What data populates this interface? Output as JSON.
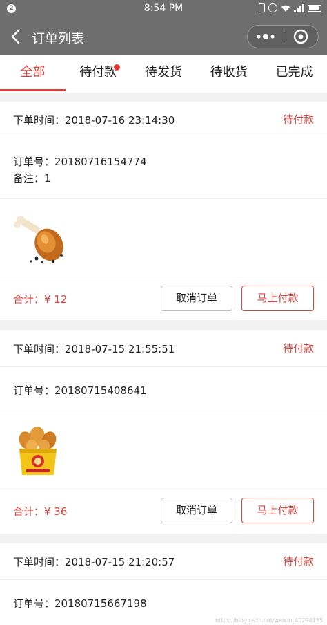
{
  "status_bar": {
    "notification_count": "2",
    "time": "8:54 PM"
  },
  "nav": {
    "title": "订单列表"
  },
  "tabs": [
    {
      "label": "全部",
      "active": true,
      "dot": false
    },
    {
      "label": "待付款",
      "active": false,
      "dot": true
    },
    {
      "label": "待发货",
      "active": false,
      "dot": false
    },
    {
      "label": "待收货",
      "active": false,
      "dot": false
    },
    {
      "label": "已完成",
      "active": false,
      "dot": false
    }
  ],
  "orders": [
    {
      "time_label": "下单时间：2018-07-16 23:14:30",
      "status": "待付款",
      "order_no": "订单号：20180716154774",
      "note": "备注：1",
      "image_icon": "chicken-drumstick",
      "total": "合计：¥ 12",
      "cancel_label": "取消订单",
      "pay_label": "马上付款"
    },
    {
      "time_label": "下单时间：2018-07-15 21:55:51",
      "status": "待付款",
      "order_no": "订单号：20180715408641",
      "image_icon": "fried-chicken-box",
      "total": "合计：¥ 36",
      "cancel_label": "取消订单",
      "pay_label": "马上付款"
    },
    {
      "time_label": "下单时间：2018-07-15 21:20:57",
      "status": "待付款",
      "order_no": "订单号：20180715667198"
    }
  ],
  "watermark": "https://blog.csdn.net/weixin_40294155",
  "colors": {
    "accent": "#d9423c",
    "header": "#6e6e6e",
    "background": "#f2f2f2"
  }
}
